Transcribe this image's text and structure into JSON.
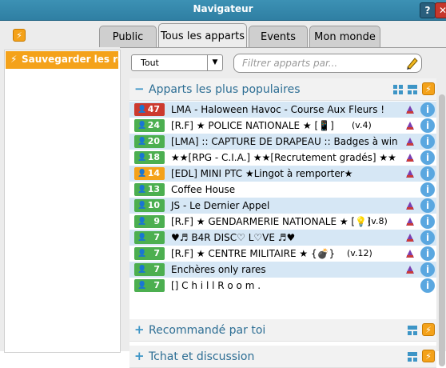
{
  "window": {
    "title": "Navigateur",
    "help_label": "?",
    "close_label": "✕"
  },
  "left": {
    "save_label": "Sauvegarder les recherches"
  },
  "tabs": [
    {
      "label": "Public",
      "active": false
    },
    {
      "label": "Tous les apparts",
      "active": true
    },
    {
      "label": "Events",
      "active": false
    },
    {
      "label": "Mon monde",
      "active": false
    }
  ],
  "filter": {
    "selected": "Tout",
    "search_placeholder": "Filtrer apparts par..."
  },
  "sections": [
    {
      "title": "Apparts les plus populaires",
      "sign": "−",
      "expanded": true
    },
    {
      "title": "Recommandé par toi",
      "sign": "+",
      "expanded": false
    },
    {
      "title": "Tchat et discussion",
      "sign": "+",
      "expanded": false
    }
  ],
  "rooms": [
    {
      "count": "47",
      "color": "#cc3a2f",
      "name": "LMA - Haloween Havoc - Course Aux Fleurs !",
      "extra": "",
      "group": true
    },
    {
      "count": "24",
      "color": "#4caf50",
      "name": "[R.F] ★ POLICE NATIONALE ★ [📱]",
      "extra": "(v.4)",
      "group": true
    },
    {
      "count": "20",
      "color": "#4caf50",
      "name": "[LMA]  ::  CAPTURE DE DRAPEAU  :: Badges à win",
      "extra": "",
      "group": true
    },
    {
      "count": "18",
      "color": "#4caf50",
      "name": "★★[RPG - C.I.A.] ★★[Recrutement gradés] ★★",
      "extra": "",
      "group": true
    },
    {
      "count": "14",
      "color": "#f4a21a",
      "name": "[EDL] MINI PTC ★Lingot à remporter★",
      "extra": "",
      "group": true
    },
    {
      "count": "13",
      "color": "#4caf50",
      "name": "Coffee House",
      "extra": "",
      "group": false
    },
    {
      "count": "10",
      "color": "#4caf50",
      "name": "JS - Le Dernier Appel",
      "extra": "",
      "group": true
    },
    {
      "count": "9",
      "color": "#4caf50",
      "name": "[R.F] ★ GENDARMERIE NATIONALE ★ [💡]",
      "extra": "(v.8)",
      "group": true
    },
    {
      "count": "7",
      "color": "#4caf50",
      "name": "♥♬ B4R DISC♡ L♡VE ♬♥",
      "extra": "",
      "group": true
    },
    {
      "count": "7",
      "color": "#4caf50",
      "name": "[R.F] ★ CENTRE MILITAIRE ★ {💣}",
      "extra": "(v.12)",
      "group": true
    },
    {
      "count": "7",
      "color": "#4caf50",
      "name": "Enchères only rares",
      "extra": "",
      "group": true
    },
    {
      "count": "7",
      "color": "#4caf50",
      "name": "[] C h i l l   R o o m .",
      "extra": "",
      "group": false
    }
  ]
}
